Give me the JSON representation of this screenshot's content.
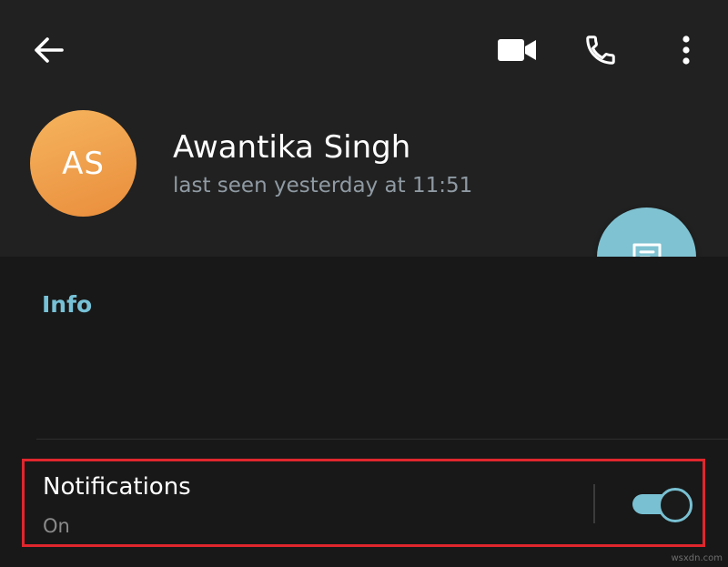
{
  "header": {
    "contact_name": "Awantika Singh",
    "last_seen": "last seen yesterday at 11:51",
    "avatar_initials": "AS",
    "avatar_color": "#f0a04a"
  },
  "icons": {
    "back": "arrow-left-icon",
    "video": "video-camera-icon",
    "call": "phone-icon",
    "more": "more-vertical-icon",
    "message": "message-icon"
  },
  "info": {
    "heading": "Info"
  },
  "notifications": {
    "title": "Notifications",
    "status": "On",
    "enabled": true,
    "highlight_color": "#e0262d"
  },
  "accent_color": "#7fc2d2",
  "watermark": "wsxdn.com"
}
